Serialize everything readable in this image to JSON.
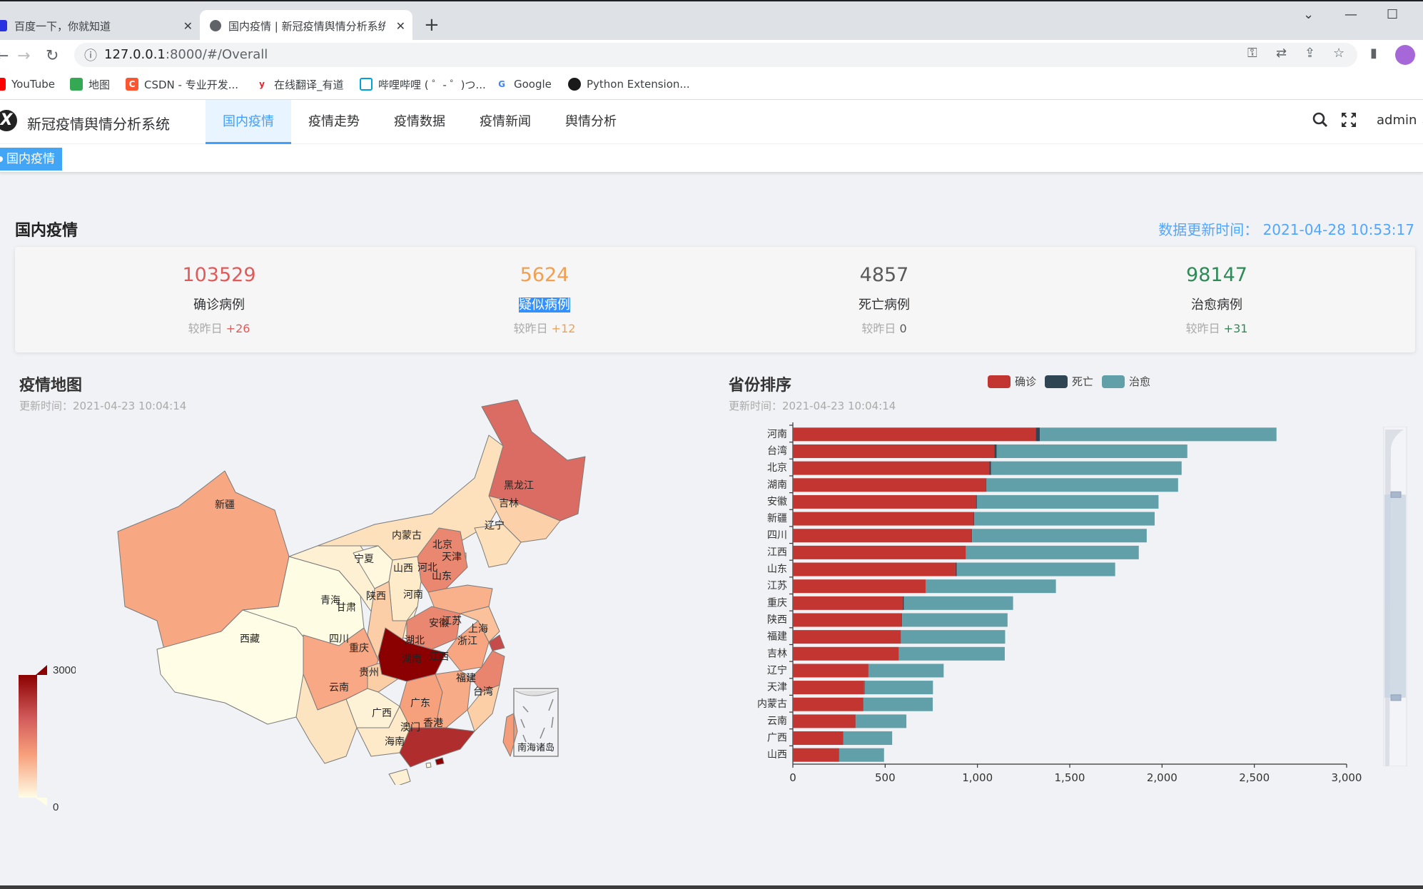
{
  "browser": {
    "tabs": [
      {
        "title": "百度一下，你就知道",
        "icon": "baidu-paw-icon",
        "active": false
      },
      {
        "title": "国内疫情 | 新冠疫情舆情分析系统",
        "icon": "globe-icon",
        "active": true
      }
    ],
    "new_tab": "+",
    "url_host": "127.0.0.1",
    "url_rest": ":8000/#/Overall",
    "bookmarks": [
      {
        "label": "YouTube",
        "icon": "youtube-icon",
        "color": "#ff0000"
      },
      {
        "label": "地图",
        "icon": "maps-icon",
        "color": "#34a853"
      },
      {
        "label": "CSDN - 专业开发...",
        "icon": "csdn-icon",
        "color": "#fc5531"
      },
      {
        "label": "在线翻译_有道",
        "icon": "youdao-icon",
        "color": "#e5242b"
      },
      {
        "label": "哔哩哔哩 ( ゜- ゜)つ...",
        "icon": "bilibili-icon",
        "color": "#00a1d6"
      },
      {
        "label": "Google",
        "icon": "google-icon",
        "color": "#4285f4"
      },
      {
        "label": "Python Extension...",
        "icon": "python-extension-icon",
        "color": "#1a1a1a"
      }
    ]
  },
  "app": {
    "title": "新冠疫情舆情分析系统",
    "menu": [
      {
        "label": "国内疫情",
        "active": true
      },
      {
        "label": "疫情走势",
        "active": false
      },
      {
        "label": "疫情数据",
        "active": false
      },
      {
        "label": "疫情新闻",
        "active": false
      },
      {
        "label": "舆情分析",
        "active": false
      }
    ],
    "user": "admin",
    "breadcrumb_tag": "国内疫情"
  },
  "overview": {
    "title": "国内疫情",
    "update_label": "数据更新时间：",
    "update_time": "2021-04-28 10:53:17",
    "compare_label": "较昨日",
    "stats": [
      {
        "value": "103529",
        "label": "确诊病例",
        "delta": "+26",
        "color": "#e05a5a",
        "selected": false
      },
      {
        "value": "5624",
        "label": "疑似病例",
        "delta": "+12",
        "color": "#f0a050",
        "selected": true
      },
      {
        "value": "4857",
        "label": "死亡病例",
        "delta": "0",
        "color": "#5a5a5a",
        "selected": false
      },
      {
        "value": "98147",
        "label": "治愈病例",
        "delta": "+31",
        "color": "#2e8b57",
        "selected": false
      }
    ]
  },
  "map_panel": {
    "title": "疫情地图",
    "subtitle": "更新时间：2021-04-23 10:04:14",
    "visual_map": {
      "max_label": "3000",
      "min_label": "0",
      "min": 0,
      "max": 3000
    },
    "inset_label": "南海诸岛",
    "provinces": [
      {
        "name": "新疆",
        "value": 980
      },
      {
        "name": "西藏",
        "value": 1
      },
      {
        "name": "青海",
        "value": 18
      },
      {
        "name": "甘肃",
        "value": 184
      },
      {
        "name": "宁夏",
        "value": 75
      },
      {
        "name": "内蒙古",
        "value": 382
      },
      {
        "name": "黑龙江",
        "value": 1612
      },
      {
        "name": "吉林",
        "value": 573
      },
      {
        "name": "辽宁",
        "value": 409
      },
      {
        "name": "北京",
        "value": 1065
      },
      {
        "name": "天津",
        "value": 386
      },
      {
        "name": "河北",
        "value": 1317
      },
      {
        "name": "山西",
        "value": 251
      },
      {
        "name": "山东",
        "value": 881
      },
      {
        "name": "陕西",
        "value": 589
      },
      {
        "name": "河南",
        "value": 1316
      },
      {
        "name": "四川",
        "value": 968
      },
      {
        "name": "重庆",
        "value": 595
      },
      {
        "name": "湖北",
        "value": 68158
      },
      {
        "name": "安徽",
        "value": 991
      },
      {
        "name": "江苏",
        "value": 719
      },
      {
        "name": "上海",
        "value": 2000
      },
      {
        "name": "浙江",
        "value": 1340
      },
      {
        "name": "湖南",
        "value": 1045
      },
      {
        "name": "江西",
        "value": 937
      },
      {
        "name": "贵州",
        "value": 147
      },
      {
        "name": "云南",
        "value": 339
      },
      {
        "name": "福建",
        "value": 585
      },
      {
        "name": "台湾",
        "value": 1092
      },
      {
        "name": "广西",
        "value": 272
      },
      {
        "name": "广东",
        "value": 2400
      },
      {
        "name": "香港",
        "value": 11800
      },
      {
        "name": "澳门",
        "value": 49
      },
      {
        "name": "海南",
        "value": 171
      }
    ]
  },
  "chart_data": {
    "type": "bar",
    "orientation": "horizontal",
    "stacked": true,
    "title": "省份排序",
    "subtitle": "更新时间：2021-04-23 10:04:14",
    "legend_position": "top",
    "categories": [
      "河南",
      "台湾",
      "北京",
      "湖南",
      "安徽",
      "新疆",
      "四川",
      "江西",
      "山东",
      "江苏",
      "重庆",
      "陕西",
      "福建",
      "吉林",
      "辽宁",
      "天津",
      "内蒙古",
      "云南",
      "广西",
      "山西"
    ],
    "series": [
      {
        "name": "确诊",
        "color": "#c23531",
        "values": [
          1316,
          1092,
          1065,
          1045,
          991,
          980,
          968,
          937,
          881,
          719,
          595,
          589,
          585,
          573,
          409,
          386,
          382,
          339,
          272,
          251
        ]
      },
      {
        "name": "死亡",
        "color": "#2f4554",
        "values": [
          22,
          12,
          9,
          4,
          6,
          3,
          3,
          1,
          7,
          0,
          6,
          3,
          1,
          2,
          2,
          3,
          1,
          2,
          2,
          0
        ]
      },
      {
        "name": "治愈",
        "color": "#61a0a8",
        "values": [
          1282,
          1033,
          1032,
          1038,
          984,
          977,
          946,
          936,
          858,
          706,
          592,
          571,
          564,
          573,
          406,
          370,
          375,
          274,
          264,
          243
        ]
      }
    ],
    "xlim": [
      0,
      3000
    ],
    "x_ticks": [
      "0",
      "500",
      "1,000",
      "1,500",
      "2,000",
      "2,500",
      "3,000"
    ],
    "x_tick_values": [
      0,
      500,
      1000,
      1500,
      2000,
      2500,
      3000
    ],
    "grid": false,
    "datazoom": {
      "start_fraction": 0.2,
      "end_fraction": 0.95
    }
  }
}
